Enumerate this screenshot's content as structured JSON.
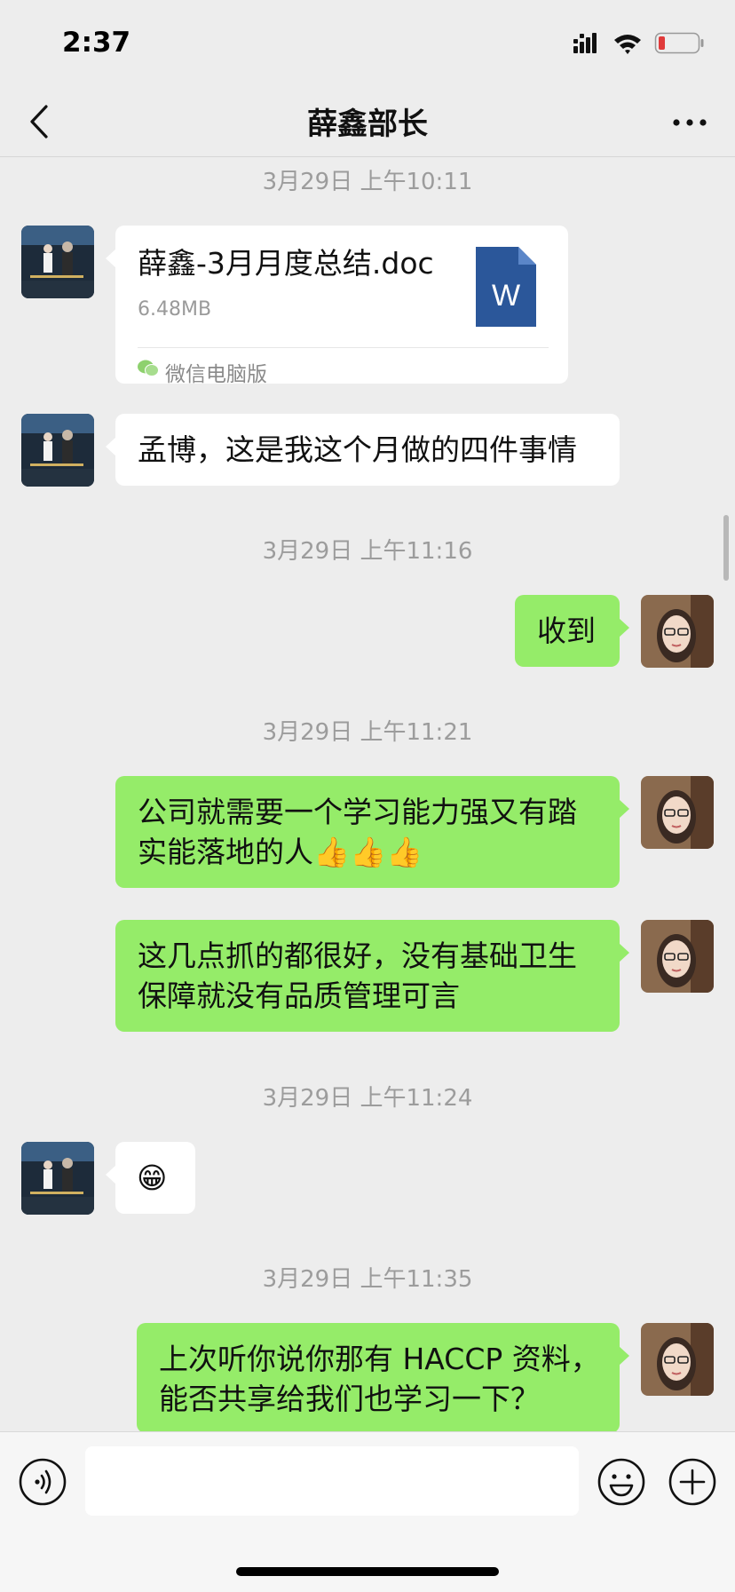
{
  "status": {
    "time": "2:37"
  },
  "nav": {
    "title": "薛鑫部长"
  },
  "messages": {
    "ts1": "3月29日 上午10:11",
    "file": {
      "name": "薛鑫-3月月度总结.doc",
      "size": "6.48MB",
      "source": "微信电脑版",
      "icon_letter": "W"
    },
    "m1": "孟博，这是我这个月做的四件事情",
    "ts2": "3月29日 上午11:16",
    "m2": "收到",
    "ts3": "3月29日 上午11:21",
    "m3": "公司就需要一个学习能力强又有踏实能落地的人👍👍👍",
    "m4": "这几点抓的都很好，没有基础卫生保障就没有品质管理可言",
    "ts4": "3月29日 上午11:24",
    "m5": "😁",
    "ts5": "3月29日 上午11:35",
    "m6": "上次听你说你那有 HACCP 资料，能否共享给我们也学习一下？"
  },
  "colors": {
    "bg": "#ededed",
    "bubble_green": "#95ec69",
    "bubble_white": "#ffffff",
    "doc_blue": "#2b579a"
  }
}
